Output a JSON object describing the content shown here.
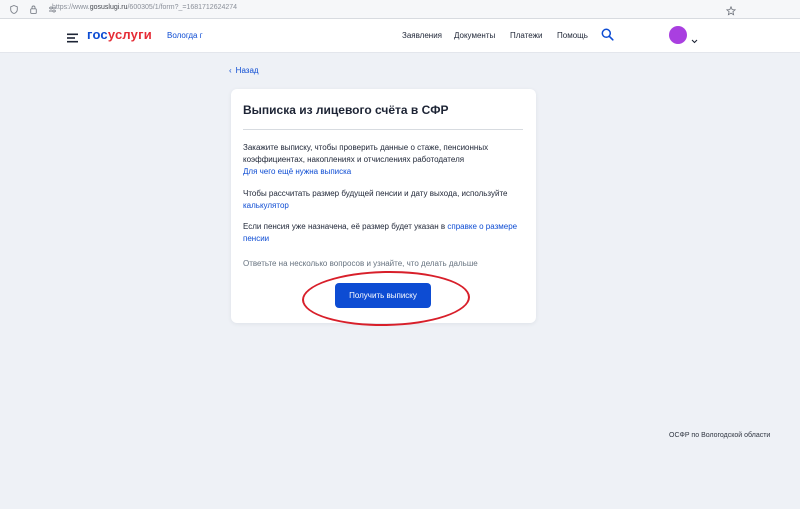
{
  "browser": {
    "url_prefix": "https://www.",
    "url_domain": "gosuslugi.ru",
    "url_path": "/600305/1/form?_=1681712624274"
  },
  "header": {
    "logo_part1": "гос",
    "logo_part2": "услуги",
    "region": "Вологда г",
    "nav": [
      "Заявления",
      "Документы",
      "Платежи",
      "Помощь"
    ],
    "avatar_color": "#a93fe0"
  },
  "back_label": "Назад",
  "card": {
    "title": "Выписка из лицевого счёта в СФР",
    "p1_text": "Закажите выписку, чтобы проверить данные о стаже, пенсионных коэффициентах, накоплениях и отчислениях работодателя",
    "p1_link": "Для чего ещё нужна выписка",
    "p2_text": "Чтобы рассчитать размер будущей пенсии и дату выхода, используйте",
    "p2_link": "калькулятор",
    "p3_text": "Если пенсия уже назначена, её размер будет указан в",
    "p3_link_line1": "справке о размере",
    "p3_link_line2": "пенсии",
    "prompt": "Ответьте на несколько вопросов и узнайте, что делать дальше",
    "button": "Получить выписку"
  },
  "footer_watermark": "ОСФР по Вологодской области",
  "colors": {
    "brand_blue": "#0d4cd3",
    "brand_red": "#e52c36",
    "highlight_oval": "#d81f2a",
    "page_bg": "#eef1f6"
  }
}
